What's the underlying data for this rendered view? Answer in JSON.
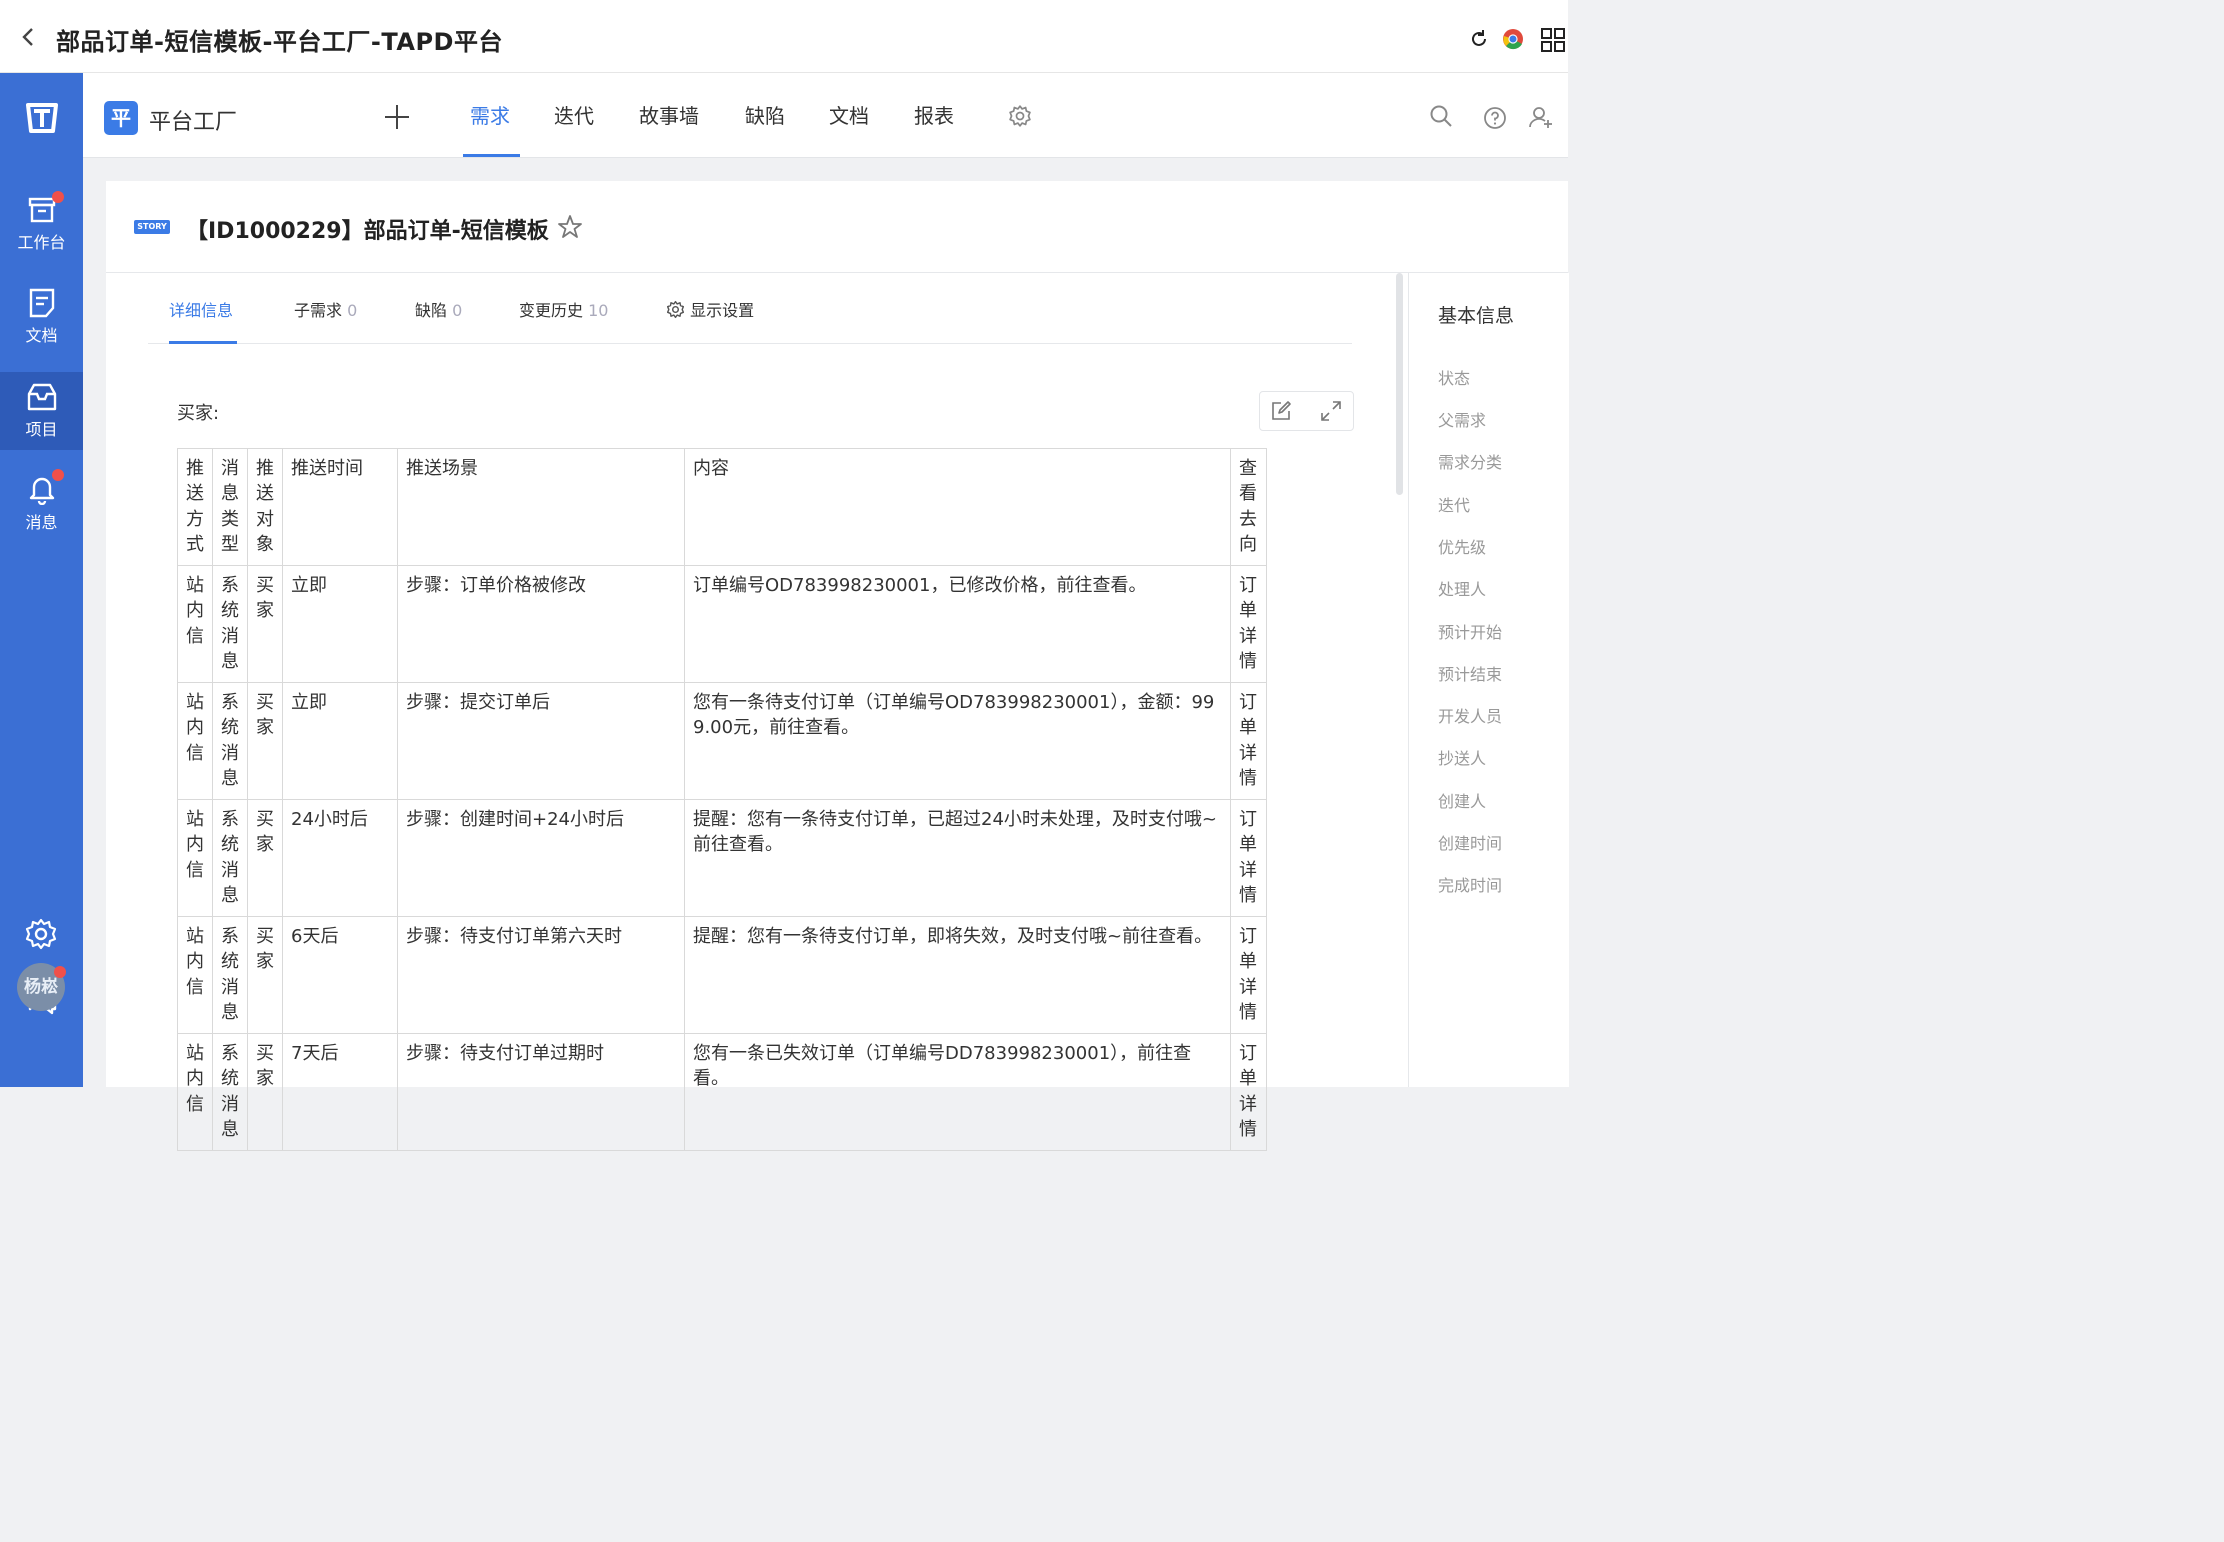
{
  "window": {
    "title": "部品订单-短信模板-平台工厂-TAPD平台"
  },
  "sidebar": {
    "items": [
      {
        "label": "工作台"
      },
      {
        "label": "文档"
      },
      {
        "label": "项目"
      },
      {
        "label": "消息"
      }
    ],
    "avatar_text": "杨崧"
  },
  "topnav": {
    "project_badge": "平",
    "project_name": "平台工厂",
    "tabs": [
      "需求",
      "迭代",
      "故事墙",
      "缺陷",
      "文档",
      "报表"
    ]
  },
  "story": {
    "badge": "STORY",
    "title": "【ID1000229】部品订单-短信模板"
  },
  "subtabs": [
    {
      "label": "详细信息",
      "count": ""
    },
    {
      "label": "子需求",
      "count": "0"
    },
    {
      "label": "缺陷",
      "count": "0"
    },
    {
      "label": "变更历史",
      "count": "10"
    },
    {
      "label": "显示设置",
      "count": ""
    }
  ],
  "section_label": "买家:",
  "table": {
    "headers": [
      "推送方式",
      "消息类型",
      "推送对象",
      "推送时间",
      "推送场景",
      "内容",
      "查看去向"
    ],
    "rows": [
      [
        "站内信",
        "系统消息",
        "买家",
        "立即",
        "步骤：订单价格被修改",
        "订单编号OD783998230001，已修改价格，前往查看。",
        "订单详情"
      ],
      [
        "站内信",
        "系统消息",
        "买家",
        "立即",
        "步骤：提交订单后",
        "您有一条待支付订单（订单编号OD783998230001），金额：999.00元，前往查看。",
        "订单详情"
      ],
      [
        "站内信",
        "系统消息",
        "买家",
        "24小时后",
        "步骤：创建时间+24小时后",
        "提醒：您有一条待支付订单，已超过24小时未处理，及时支付哦~前往查看。",
        "订单详情"
      ],
      [
        "站内信",
        "系统消息",
        "买家",
        "6天后",
        "步骤：待支付订单第六天时",
        "提醒：您有一条待支付订单，即将失效，及时支付哦~前往查看。",
        "订单详情"
      ],
      [
        "站内信",
        "系统消息",
        "买家",
        "7天后",
        "步骤：待支付订单过期时",
        "您有一条已失效订单（订单编号DD783998230001），前往查看。",
        "订单详情"
      ]
    ]
  },
  "right_panel": {
    "title": "基本信息",
    "fields": [
      "状态",
      "父需求",
      "需求分类",
      "迭代",
      "优先级",
      "处理人",
      "预计开始",
      "预计结束",
      "开发人员",
      "抄送人",
      "创建人",
      "创建时间",
      "完成时间"
    ]
  }
}
